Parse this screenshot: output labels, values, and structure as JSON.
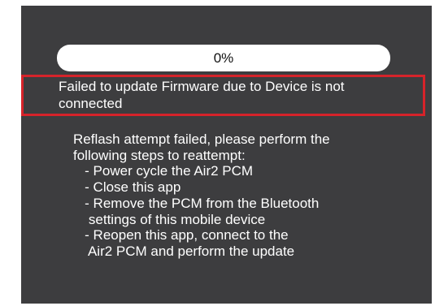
{
  "colors": {
    "screen_background": "#3d3d3f",
    "progress_track": "#ffffff",
    "error_border": "#d6232a",
    "text": "#ffffff"
  },
  "progress": {
    "label": "0%",
    "value": 0
  },
  "error": {
    "message": " Failed to update Firmware due to Device is not\nconnected"
  },
  "instructions": {
    "lines": [
      "Reflash attempt failed, please perform the",
      "following steps to reattempt:",
      "   - Power cycle the Air2 PCM",
      "   - Close this app",
      "   - Remove the PCM from the Bluetooth",
      "    settings of this mobile device",
      "   - Reopen this app, connect to the",
      "    Air2 PCM and perform the update"
    ]
  }
}
